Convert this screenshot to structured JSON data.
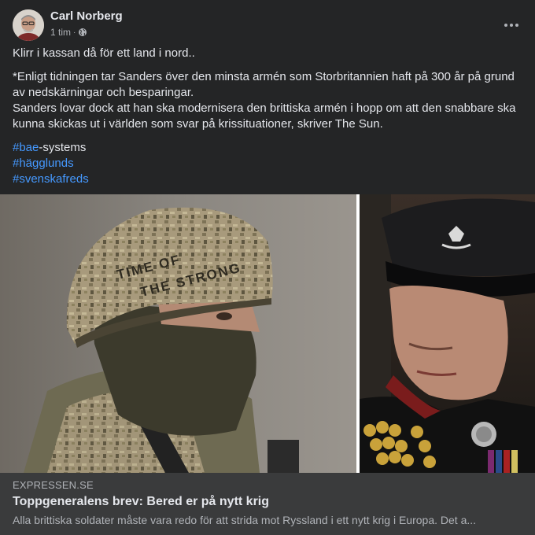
{
  "post": {
    "author": "Carl Norberg",
    "time": "1 tim",
    "separator": "·",
    "text": {
      "line1": "Klirr i kassan då för ett land i nord..",
      "para2": "*Enligt tidningen tar Sanders över den minsta armén som Storbritannien haft på 300 år på grund av nedskärningar och besparingar.",
      "para3": "Sanders lovar dock att han ska modernisera den brittiska armén i hopp om att den snabbare ska kunna skickas ut i världen som svar på krissituationer, skriver The Sun."
    },
    "hashtags": [
      {
        "hash": "#bae",
        "rest": "-systems"
      },
      {
        "hash": "#hägglunds",
        "rest": ""
      },
      {
        "hash": "#svenskafreds",
        "rest": ""
      }
    ]
  },
  "media": {
    "helmet_text_line1": "TIME OF",
    "helmet_text_line2": "THE STRONG"
  },
  "link": {
    "domain": "EXPRESSEN.SE",
    "title": "Toppgeneralens brev: Bered er på nytt krig",
    "description": "Alla brittiska soldater måste vara redo för att strida mot Ryssland i ett nytt krig i Europa. Det a..."
  },
  "icons": {
    "globe": "globe-icon",
    "more": "more-options-icon"
  },
  "colors": {
    "background": "#242526",
    "link_blue": "#4599ff",
    "linkbox": "#3a3b3c",
    "secondary_text": "#b0b3b8"
  }
}
